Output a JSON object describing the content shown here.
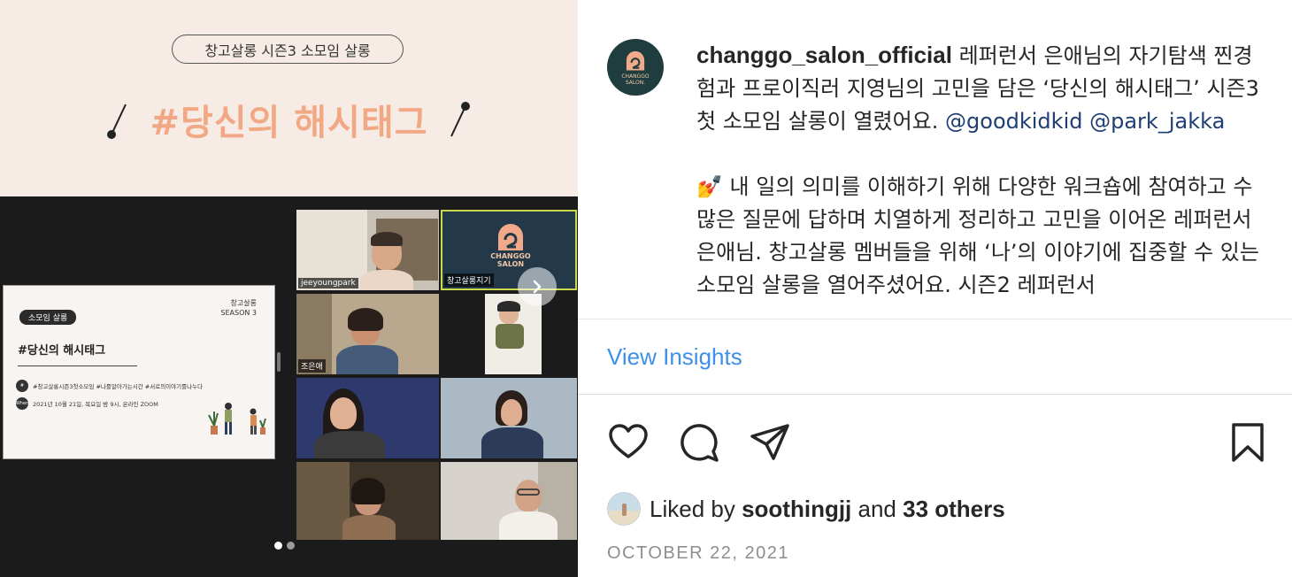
{
  "image": {
    "pill_text": "창고살롱 시즌3 소모임 살롱",
    "title": "#당신의 해시태그",
    "slide": {
      "tag": "소모임 살롱",
      "brand": "창고살롱",
      "season": "SEASON 3",
      "title": "#당신의 해시태그",
      "hashtags": "#창고살롱시즌3첫소모임   #나를알아가는시간   #서로의이야기를나누다",
      "when_label": "When",
      "when": "2021년 10월 21일, 목요일 밤 9시, 온라인 ZOOM"
    },
    "tiles": [
      {
        "name": "jeeyoungpark"
      },
      {
        "name": "창고살롱지기"
      },
      {
        "name": "조은애"
      }
    ],
    "logo_text": "CHANGGO\nSALON",
    "carousel_dots": 2,
    "carousel_active": 0
  },
  "post": {
    "username": "changgo_salon_official",
    "caption_intro": " 레퍼런서 은애님의 자기탐색 찐경험과 프로이직러 지영님의 고민을 담은 ‘당신의 해시태그’ 시즌3 첫 소모임 살롱이 열렸어요. ",
    "mention_1": "@goodkidkid",
    "mention_2": "@park_jakka",
    "caption_body": "내 일의 의미를 이해하기 위해 다양한 워크숍에 참여하고 수많은 질문에 답하며 치열하게 정리하고 고민을 이어온 레퍼런서 은애님. 창고살롱 멤버들을 위해 ‘나’의 이야기에 집중할 수 있는 소모임 살롱을 열어주셨어요. 시즌2 레퍼런서",
    "emoji": "💅",
    "view_insights": "View Insights",
    "liked_prefix": "Liked by ",
    "liked_user": "soothingjj",
    "liked_mid": " and ",
    "liked_others": "33 others",
    "date": "OCTOBER 22, 2021"
  },
  "icons": [
    "heart-icon",
    "comment-icon",
    "share-icon",
    "bookmark-icon",
    "chevron-right-icon"
  ],
  "colors": {
    "accent_link": "#3f8fe8",
    "mention": "#1e3f73",
    "title_peach": "#f2a884",
    "avatar_bg": "#1f3d3e"
  }
}
